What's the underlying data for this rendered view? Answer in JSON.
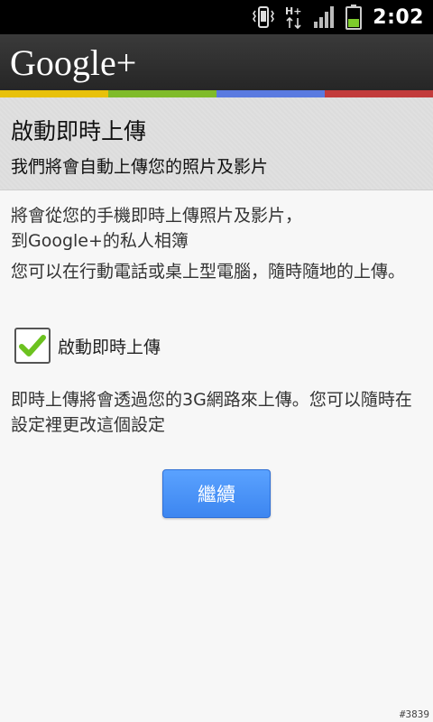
{
  "status_bar": {
    "network_label": "H+",
    "clock": "2:02",
    "colors": {
      "battery": "#7ecb2c"
    }
  },
  "app_bar": {
    "logo_text": "Google+",
    "stripe_colors": [
      "#e8c10b",
      "#7fbb2a",
      "#5a7ae0",
      "#c23b3b"
    ]
  },
  "header": {
    "title": "啟動即時上傳",
    "subtitle": "我們將會自動上傳您的照片及影片"
  },
  "body": {
    "paragraph1": "將會從您的手機即時上傳照片及影片，到Google+的私人相簿",
    "paragraph2": "您可以在行動電話或桌上型電腦，隨時隨地的上傳。",
    "checkbox": {
      "label": "啟動即時上傳",
      "checked": true
    },
    "paragraph3": "即時上傳將會透過您的3G網路來上傳。您可以隨時在設定裡更改這個設定",
    "continue_button": "繼續"
  },
  "watermark": "#3839"
}
